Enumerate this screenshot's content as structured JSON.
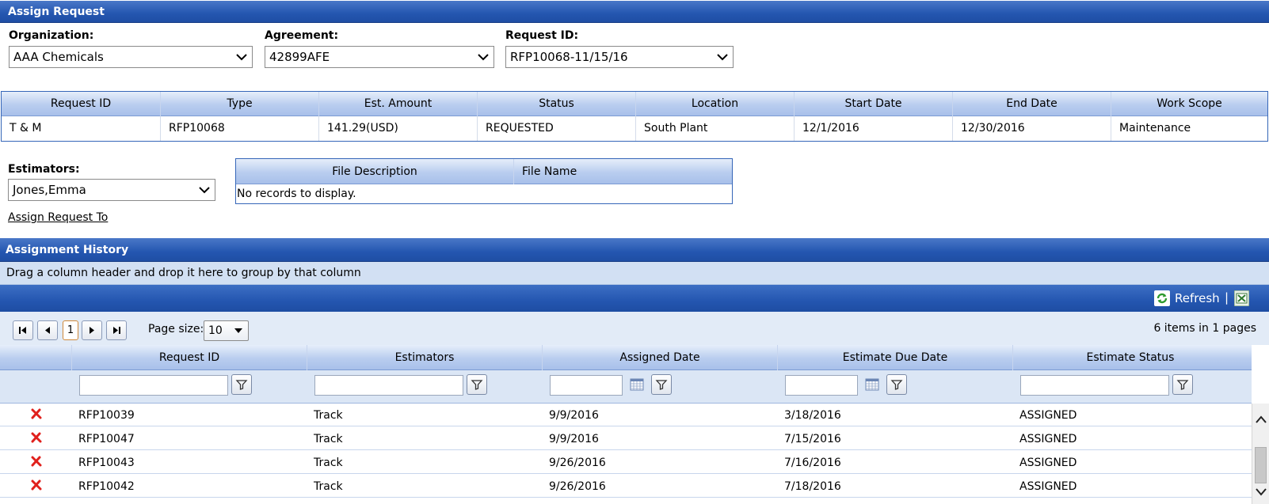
{
  "assign_request": {
    "title": "Assign Request",
    "organization": {
      "label": "Organization:",
      "value": "AAA Chemicals"
    },
    "agreement": {
      "label": "Agreement:",
      "value": "42899AFE"
    },
    "request_id": {
      "label": "Request ID:",
      "value": "RFP10068-11/15/16"
    }
  },
  "request_grid": {
    "columns": [
      "Request ID",
      "Type",
      "Est. Amount",
      "Status",
      "Location",
      "Start Date",
      "End Date",
      "Work Scope"
    ],
    "row": [
      "T & M",
      "RFP10068",
      "141.29(USD)",
      "REQUESTED",
      "South Plant",
      "12/1/2016",
      "12/30/2016",
      "Maintenance"
    ]
  },
  "estimators": {
    "label": "Estimators:",
    "value": "Jones,Emma"
  },
  "assign_link": "Assign Request To",
  "file_grid": {
    "columns": [
      "File Description",
      "File Name"
    ],
    "empty": "No records to display."
  },
  "assignment_history": {
    "title": "Assignment History",
    "group_hint": "Drag a column header and drop it here to group by that column",
    "refresh_label": "Refresh",
    "separator": "|",
    "pager": {
      "current_page": "1",
      "page_size_label": "Page size:",
      "page_size": "10",
      "summary": "6 items in 1 pages"
    },
    "columns": [
      "Request ID",
      "Estimators",
      "Assigned Date",
      "Estimate Due Date",
      "Estimate Status"
    ],
    "rows": [
      [
        "RFP10039",
        "Track",
        "9/9/2016",
        "3/18/2016",
        "ASSIGNED"
      ],
      [
        "RFP10047",
        "Track",
        "9/9/2016",
        "7/15/2016",
        "ASSIGNED"
      ],
      [
        "RFP10043",
        "Track",
        "9/26/2016",
        "7/16/2016",
        "ASSIGNED"
      ],
      [
        "RFP10042",
        "Track",
        "9/26/2016",
        "7/18/2016",
        "ASSIGNED"
      ]
    ]
  },
  "colors": {
    "header_blue": "#2456b0",
    "delete_red": "#e0201c"
  }
}
